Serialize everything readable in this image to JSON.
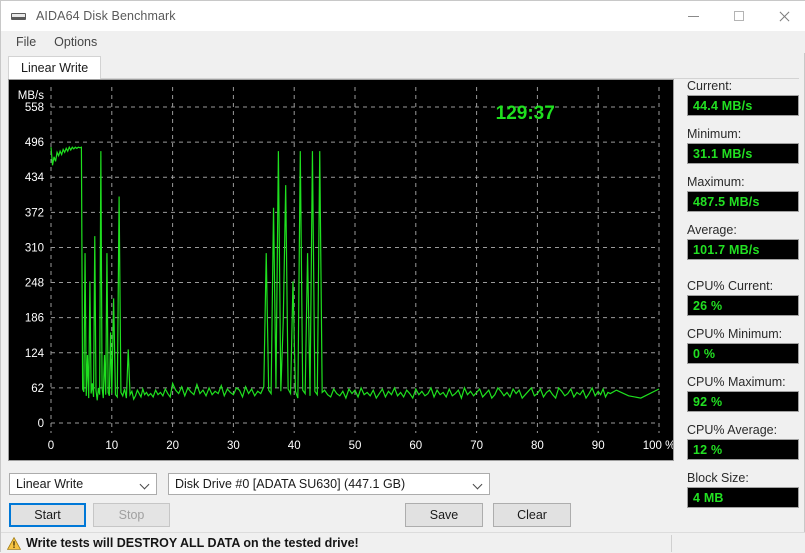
{
  "window": {
    "title": "AIDA64 Disk Benchmark",
    "icon": "disk-icon",
    "controls": {
      "minimize": "minimize-icon",
      "maximize": "maximize-icon",
      "close": "close-icon"
    }
  },
  "menu": {
    "items": [
      "File",
      "Options"
    ]
  },
  "tabs": [
    {
      "label": "Linear Write",
      "active": true
    }
  ],
  "chart_data": {
    "type": "line",
    "title": "",
    "timer": "129:37",
    "xlabel": "",
    "ylabel": "MB/s",
    "x_unit": "%",
    "xlim": [
      0,
      100
    ],
    "ylim": [
      0,
      558
    ],
    "xticks": [
      0,
      10,
      20,
      30,
      40,
      50,
      60,
      70,
      80,
      90,
      100
    ],
    "xticklabels": [
      "0",
      "10",
      "20",
      "30",
      "40",
      "50",
      "60",
      "70",
      "80",
      "90",
      "100 %"
    ],
    "yticks": [
      0,
      62,
      124,
      186,
      248,
      310,
      372,
      434,
      496,
      558
    ],
    "yticklabels": [
      "0",
      "62",
      "124",
      "186",
      "248",
      "310",
      "372",
      "434",
      "496",
      "558"
    ],
    "grid": true,
    "grid_color": "#9a9a9a",
    "line_color": "#1fe01f",
    "background": "#000000",
    "series": [
      {
        "name": "Linear Write",
        "x": [
          0.0,
          0.25,
          0.5,
          0.75,
          1.0,
          1.25,
          1.5,
          1.75,
          2.0,
          2.25,
          2.5,
          2.75,
          3.0,
          3.25,
          3.5,
          3.75,
          4.0,
          4.25,
          4.5,
          4.75,
          5.0,
          5.2,
          5.4,
          5.6,
          5.8,
          6.0,
          6.2,
          6.4,
          6.6,
          6.8,
          7.0,
          7.2,
          7.4,
          7.6,
          7.8,
          8.0,
          8.2,
          8.4,
          8.6,
          8.8,
          9.0,
          9.2,
          9.4,
          9.6,
          9.8,
          10.0,
          10.3,
          10.6,
          10.9,
          11.2,
          11.5,
          11.8,
          12.1,
          12.4,
          12.7,
          13.0,
          13.3,
          13.6,
          13.9,
          14.2,
          14.5,
          14.8,
          15.1,
          15.4,
          15.7,
          16.0,
          16.4,
          16.8,
          17.2,
          17.6,
          18.0,
          18.4,
          18.8,
          19.2,
          19.6,
          20.0,
          20.5,
          21.0,
          21.5,
          22.0,
          22.5,
          23.0,
          23.5,
          24.0,
          24.5,
          25.0,
          25.5,
          26.0,
          26.5,
          27.0,
          27.5,
          28.0,
          28.5,
          29.0,
          29.5,
          30.0,
          30.5,
          31.0,
          31.5,
          32.0,
          32.5,
          33.0,
          33.5,
          34.0,
          34.5,
          35.0,
          35.4,
          35.8,
          36.2,
          36.6,
          37.0,
          37.4,
          37.8,
          38.2,
          38.6,
          39.0,
          39.4,
          39.8,
          40.2,
          40.6,
          41.0,
          41.4,
          41.8,
          42.2,
          42.6,
          43.0,
          43.4,
          43.8,
          44.2,
          44.6,
          45.0,
          45.5,
          46.0,
          46.5,
          47.0,
          47.5,
          48.0,
          48.5,
          49.0,
          49.5,
          50.0,
          50.5,
          51.0,
          51.5,
          52.0,
          52.5,
          53.0,
          53.5,
          54.0,
          54.5,
          55.0,
          55.5,
          56.0,
          56.5,
          57.0,
          57.5,
          58.0,
          58.5,
          59.0,
          59.5,
          60.0,
          60.5,
          61.0,
          61.5,
          62.0,
          62.5,
          63.0,
          63.5,
          64.0,
          64.5,
          65.0,
          65.5,
          66.0,
          66.5,
          67.0,
          67.5,
          68.0,
          68.5,
          69.0,
          69.5,
          70.0,
          70.5,
          71.0,
          71.5,
          72.0,
          72.5,
          73.0,
          73.5,
          74.0,
          74.5,
          75.0,
          75.5,
          76.0,
          76.5,
          77.0,
          77.5,
          78.0,
          78.5,
          79.0,
          79.5,
          80.0,
          80.5,
          81.0,
          81.5,
          82.0,
          82.5,
          83.0,
          83.5,
          84.0,
          84.5,
          85.0,
          85.5,
          86.0,
          86.5,
          87.0,
          87.5,
          88.0,
          88.5,
          89.0,
          89.5,
          90.0,
          90.4,
          90.8,
          91.2,
          91.6,
          92.0,
          93.0,
          95.0,
          97.0,
          100.0
        ],
        "y": [
          487,
          455,
          470,
          462,
          478,
          472,
          480,
          474,
          483,
          478,
          485,
          480,
          487,
          482,
          487,
          484,
          487,
          485,
          487,
          486,
          487,
          60,
          55,
          300,
          48,
          120,
          44,
          250,
          52,
          70,
          46,
          330,
          58,
          40,
          62,
          50,
          480,
          62,
          44,
          120,
          50,
          300,
          54,
          48,
          160,
          52,
          220,
          50,
          46,
          400,
          54,
          48,
          60,
          44,
          130,
          50,
          56,
          42,
          48,
          58,
          52,
          46,
          60,
          50,
          54,
          48,
          52,
          46,
          58,
          50,
          54,
          48,
          60,
          52,
          46,
          70,
          58,
          52,
          64,
          48,
          62,
          55,
          50,
          68,
          52,
          58,
          48,
          62,
          50,
          56,
          52,
          66,
          48,
          60,
          54,
          50,
          62,
          58,
          46,
          64,
          52,
          60,
          48,
          56,
          52,
          64,
          300,
          58,
          52,
          380,
          62,
          480,
          56,
          180,
          420,
          60,
          52,
          250,
          56,
          44,
          480,
          58,
          52,
          300,
          48,
          480,
          56,
          50,
          480,
          54,
          58,
          50,
          46,
          60,
          52,
          48,
          56,
          44,
          60,
          52,
          58,
          46,
          62,
          50,
          54,
          48,
          58,
          44,
          52,
          60,
          46,
          56,
          50,
          62,
          48,
          54,
          46,
          58,
          52,
          44,
          60,
          50,
          56,
          48,
          52,
          62,
          46,
          58,
          50,
          54,
          46,
          60,
          48,
          52,
          58,
          44,
          62,
          50,
          56,
          48,
          54,
          60,
          46,
          52,
          58,
          44,
          50,
          62,
          56,
          48,
          54,
          46,
          60,
          52,
          58,
          44,
          50,
          56,
          62,
          48,
          52,
          60,
          46,
          54,
          58,
          50,
          44,
          62,
          56,
          48,
          52,
          60,
          46,
          54,
          50,
          58,
          44,
          52,
          62,
          48,
          56,
          50,
          60,
          46,
          54,
          52,
          58,
          48,
          44,
          60,
          56,
          50,
          62,
          46,
          54,
          48,
          58,
          52,
          44,
          60,
          50,
          56,
          62,
          48,
          52,
          46,
          58,
          54,
          50,
          60,
          44,
          56,
          48,
          52,
          62,
          50,
          46,
          58,
          54,
          48,
          60,
          52,
          56,
          44,
          50,
          62,
          48,
          54,
          58,
          46,
          52,
          60,
          50,
          480,
          58,
          52,
          46,
          480,
          60,
          54,
          48,
          480,
          52,
          56,
          44,
          480,
          50,
          58,
          46,
          480,
          54,
          48,
          52,
          480,
          56,
          44,
          50,
          480,
          60,
          52,
          46,
          480,
          54,
          48,
          58,
          480,
          50,
          44,
          56,
          480,
          48,
          52,
          46,
          38,
          36,
          44,
          40,
          60,
          48,
          44,
          44,
          44,
          44,
          44,
          44
        ]
      }
    ],
    "notes": "Initial sequential plateau ~487 MB/s until ~5%, then heavy fluctuation ~44-62 MB/s with periodic spikes to ~480 MB/s; flat tail at ~44 MB/s after ~91%."
  },
  "stats": [
    {
      "label": "Current:",
      "value": "44.4 MB/s",
      "gap": false
    },
    {
      "label": "Minimum:",
      "value": "31.1 MB/s",
      "gap": false
    },
    {
      "label": "Maximum:",
      "value": "487.5 MB/s",
      "gap": false
    },
    {
      "label": "Average:",
      "value": "101.7 MB/s",
      "gap": true
    },
    {
      "label": "CPU% Current:",
      "value": "26 %",
      "gap": false
    },
    {
      "label": "CPU% Minimum:",
      "value": "0 %",
      "gap": false
    },
    {
      "label": "CPU% Maximum:",
      "value": "92 %",
      "gap": false
    },
    {
      "label": "CPU% Average:",
      "value": "12 %",
      "gap": false
    },
    {
      "label": "Block Size:",
      "value": "4 MB",
      "gap": false
    }
  ],
  "controls": {
    "test_select": {
      "value": "Linear Write"
    },
    "disk_select": {
      "value": "Disk Drive #0  [ADATA SU630]  (447.1 GB)"
    },
    "start_button": "Start",
    "stop_button": "Stop",
    "save_button": "Save",
    "clear_button": "Clear"
  },
  "statusbar": {
    "warning_icon": "warning-icon",
    "text": "Write tests will DESTROY ALL DATA on the tested drive!"
  },
  "colors": {
    "accent": "#0078d7",
    "graph_line": "#22e022",
    "graph_bg": "#000000",
    "warning": "#f0b400"
  }
}
